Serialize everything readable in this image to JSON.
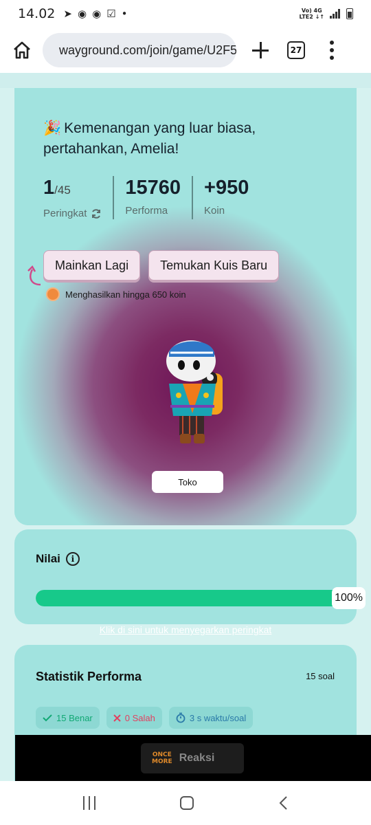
{
  "status_bar": {
    "time": "14.02",
    "network_top": "Vo) 4G",
    "network_bottom": "LTE2 ↓↑"
  },
  "browser": {
    "url": "wayground.com/join/game/U2F5",
    "tab_count": "27"
  },
  "result": {
    "emoji": "🎉",
    "title": "Kemenangan yang luar biasa, pertahankan, Amelia!",
    "rank": "1",
    "rank_total": "/45",
    "rank_label": "Peringkat",
    "performance": "15760",
    "performance_label": "Performa",
    "coins": "+950",
    "coins_label": "Koin",
    "play_again": "Mainkan Lagi",
    "find_quiz": "Temukan Kuis Baru",
    "earn_note": "Menghasilkan hingga 650 koin",
    "shop": "Toko"
  },
  "score": {
    "title": "Nilai",
    "percent": 100,
    "percent_label": "100%"
  },
  "refresh_link": "Klik di sini untuk menyegarkan peringkat",
  "performance_stats": {
    "title": "Statistik Performa",
    "question_count": "15 soal",
    "correct": "15 Benar",
    "wrong": "0 Salah",
    "time_per_question": "3 s waktu/soal"
  },
  "reaction_bar": {
    "logo_top": "ONCE",
    "logo_bottom": "MORE",
    "label": "Reaksi"
  },
  "colors": {
    "accent_green": "#17c98a",
    "card_teal": "#a1e3df",
    "wrong_red": "#e2405f",
    "time_blue": "#2a7aa8"
  }
}
